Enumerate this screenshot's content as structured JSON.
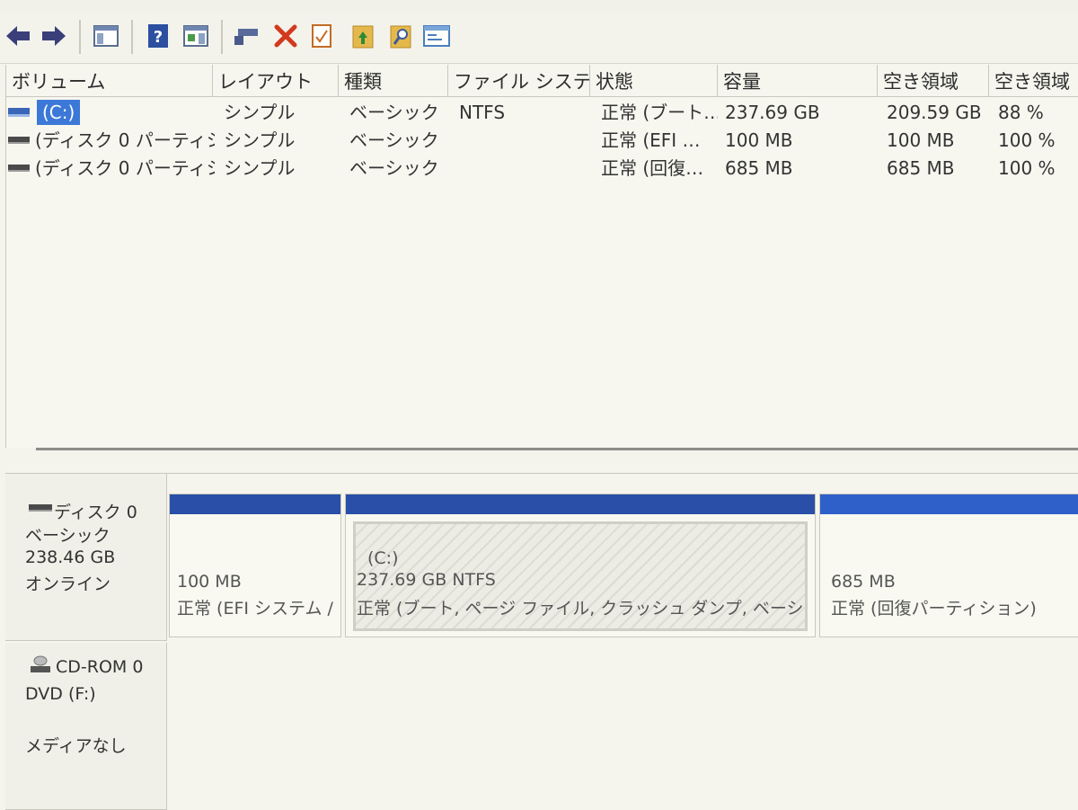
{
  "toolbar": {
    "buttons": [
      {
        "icon": "back-arrow-icon",
        "color": "#3a3f7a"
      },
      {
        "icon": "forward-arrow-icon",
        "color": "#3a3f7a"
      },
      {
        "icon": "console-tree-icon",
        "color": "#5a6e8c"
      },
      {
        "icon": "help-icon",
        "color": "#2c4fa0"
      },
      {
        "icon": "action-pane-icon",
        "color": "#5a6e8c"
      },
      {
        "icon": "connect-drive-icon",
        "color": "#4a5a8a"
      },
      {
        "icon": "delete-icon",
        "color": "#d23a1e"
      },
      {
        "icon": "check-icon",
        "color": "#c46a24"
      },
      {
        "icon": "folder-up-icon",
        "color": "#d8a63a"
      },
      {
        "icon": "folder-search-icon",
        "color": "#d8a63a"
      },
      {
        "icon": "properties-icon",
        "color": "#4a7fbf"
      }
    ]
  },
  "volume_list": {
    "columns": [
      "ボリューム",
      "レイアウト",
      "種類",
      "ファイル システム",
      "状態",
      "容量",
      "空き領域",
      "空き領域"
    ],
    "rows": [
      {
        "volume": "(C:)",
        "layout": "シンプル",
        "type": "ベーシック",
        "fs": "NTFS",
        "status": "正常 (ブート…",
        "capacity": "237.69 GB",
        "free": "209.59 GB",
        "pct": "88 %",
        "selected": true
      },
      {
        "volume": "(ディスク 0 パーティシ…",
        "layout": "シンプル",
        "type": "ベーシック",
        "fs": "",
        "status": "正常 (EFI …",
        "capacity": "100 MB",
        "free": "100 MB",
        "pct": "100 %",
        "selected": false
      },
      {
        "volume": "(ディスク 0 パーティシ…",
        "layout": "シンプル",
        "type": "ベーシック",
        "fs": "",
        "status": "正常 (回復…",
        "capacity": "685 MB",
        "free": "685 MB",
        "pct": "100 %",
        "selected": false
      }
    ]
  },
  "disks": [
    {
      "name": "ディスク 0",
      "type": "ベーシック",
      "size": "238.46 GB",
      "state": "オンライン",
      "partitions": [
        {
          "title": "",
          "size": "100 MB",
          "status": "正常 (EFI システム /"
        },
        {
          "title": "(C:)",
          "size": "237.69 GB NTFS",
          "status": "正常 (ブート, ページ ファイル, クラッシュ ダンプ, ベーシック デー"
        },
        {
          "title": "",
          "size": "685 MB",
          "status": "正常 (回復パーティション)"
        }
      ]
    },
    {
      "name": "CD-ROM 0",
      "type": "DVD (F:)",
      "state": "メディアなし"
    }
  ],
  "colors": {
    "partition_bar": "#2a4fa8",
    "partition_bar_recovery": "#2f5fc8",
    "selection": "#3c78d8"
  }
}
